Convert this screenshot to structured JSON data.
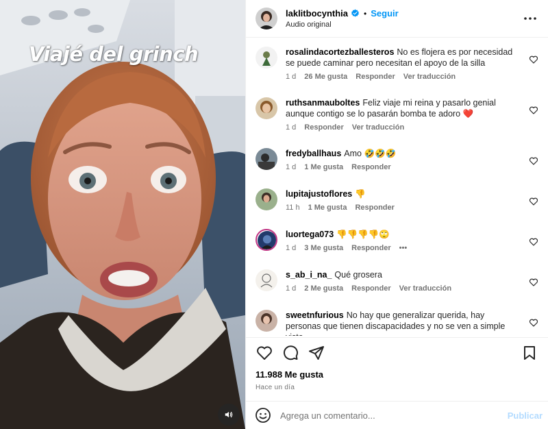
{
  "media": {
    "caption": "Viajé del grinch",
    "audio_icon": "speaker-icon"
  },
  "header": {
    "username": "laklitbocynthia",
    "separator": "•",
    "follow_label": "Seguir",
    "audio": "Audio original",
    "verified_icon": "verified-badge-icon",
    "more_icon": "more-horizontal-icon"
  },
  "comments": [
    {
      "user": "rosalindacortezballesteros",
      "text": "No es flojera es por necesidad se puede caminar pero necesitan el apoyo de la silla",
      "time": "1 d",
      "likes": "26 Me gusta",
      "reply": "Responder",
      "translate": "Ver traducción"
    },
    {
      "user": "ruthsanmauboltes",
      "text": "Feliz viaje mi reina y pasarlo genial aunque contigo se lo pasarán bomba te adoro ❤️",
      "time": "1 d",
      "reply": "Responder",
      "translate": "Ver traducción"
    },
    {
      "user": "fredyballhaus",
      "text": "Amo 🤣🤣🤣",
      "time": "1 d",
      "likes": "1 Me gusta",
      "reply": "Responder"
    },
    {
      "user": "lupitajustoflores",
      "text": "👎",
      "time": "11 h",
      "likes": "1 Me gusta",
      "reply": "Responder"
    },
    {
      "user": "luortega073",
      "text": "👎👎👎👎🙄",
      "time": "1 d",
      "likes": "3 Me gusta",
      "reply": "Responder",
      "more": "•••"
    },
    {
      "user": "s_ab_i_na_",
      "text": "Qué grosera",
      "time": "1 d",
      "likes": "2 Me gusta",
      "reply": "Responder",
      "translate": "Ver traducción"
    },
    {
      "user": "sweetnfurious",
      "text": "No hay que generalizar querida, hay personas que tienen discapacidades y no se ven a simple vista."
    }
  ],
  "actions": {
    "like_icon": "heart-icon",
    "comment_icon": "comment-icon",
    "share_icon": "share-icon",
    "save_icon": "bookmark-icon",
    "likes_count": "11.988 Me gusta",
    "posted": "Hace un día"
  },
  "composer": {
    "emoji_icon": "emoji-icon",
    "placeholder": "Agrega un comentario...",
    "publish_label": "Publicar"
  },
  "colors": {
    "link": "#0095f6",
    "muted": "#737373",
    "publish_disabled": "#b3dbff",
    "heart_red": "#ed1d36"
  }
}
